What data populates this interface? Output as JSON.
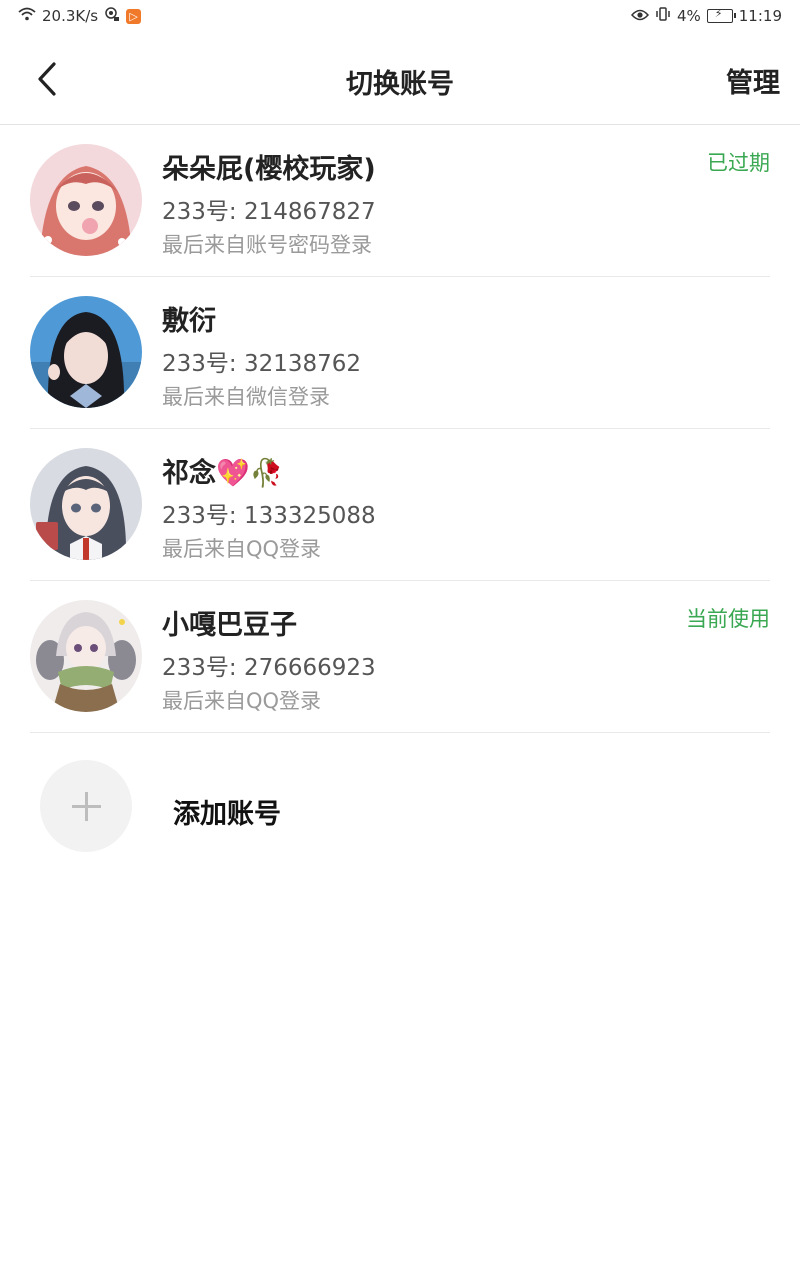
{
  "status_bar": {
    "network_speed": "20.3K/s",
    "battery_percent": "4%",
    "time": "11:19",
    "icons": [
      "wifi-icon",
      "camera-app-icon",
      "video-app-icon",
      "eye-icon",
      "vibrate-icon",
      "battery-charging-icon"
    ]
  },
  "header": {
    "title": "切换账号",
    "manage_label": "管理",
    "back_icon": "chevron-left-icon"
  },
  "accounts": [
    {
      "name": "朵朵屁(樱校玩家)",
      "uid": "233号: 214867827",
      "login": "最后来自账号密码登录",
      "status": "已过期"
    },
    {
      "name": "敷衍",
      "uid": "233号: 32138762",
      "login": "最后来自微信登录",
      "status": ""
    },
    {
      "name": "祁念💖🥀",
      "uid": "233号: 133325088",
      "login": "最后来自QQ登录",
      "status": ""
    },
    {
      "name": "小嘎巴豆子",
      "uid": "233号: 276666923",
      "login": "最后来自QQ登录",
      "status": "当前使用"
    }
  ],
  "add_account": {
    "label": "添加账号",
    "icon": "plus-icon"
  },
  "colors": {
    "status_green": "#3aa852",
    "divider": "#e9e9e9",
    "secondary_text": "#9a9a9a"
  }
}
